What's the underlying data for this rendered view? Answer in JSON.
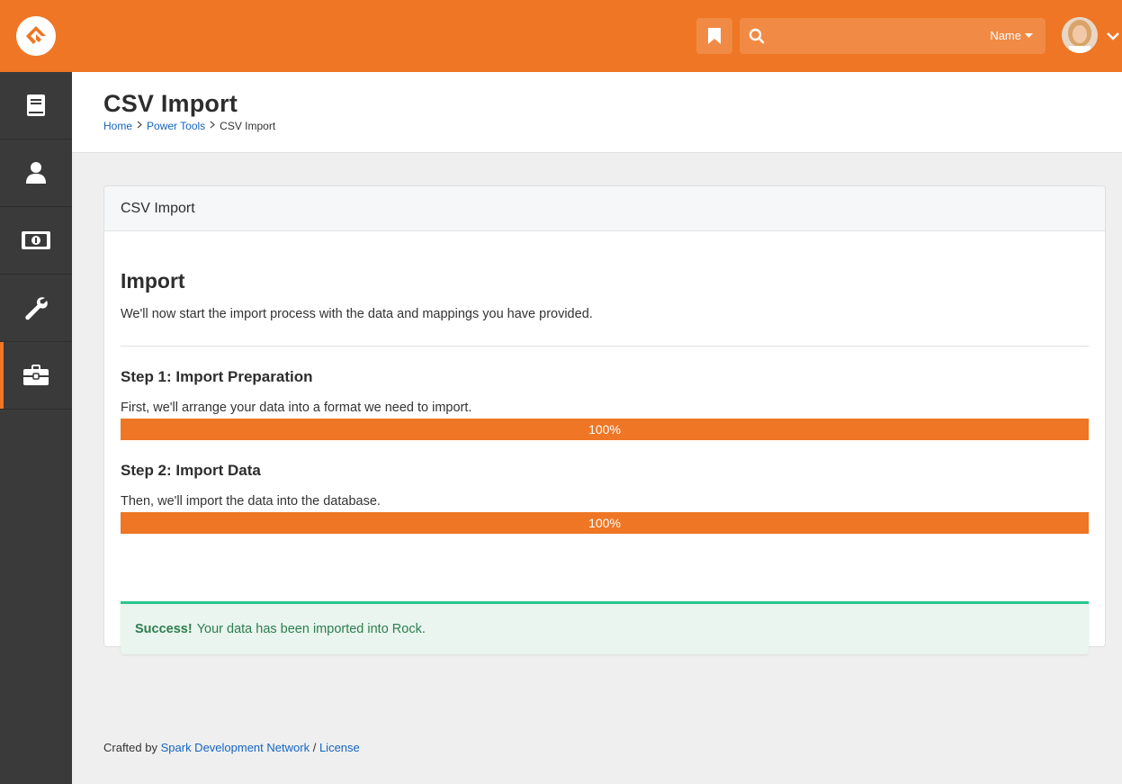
{
  "topbar": {
    "search_placeholder": "",
    "search_scope_label": "Name",
    "brand_color": "#ee7624"
  },
  "sidebar": {
    "items": [
      {
        "icon": "book-icon",
        "active": false
      },
      {
        "icon": "person-icon",
        "active": false
      },
      {
        "icon": "money-icon",
        "active": false
      },
      {
        "icon": "wrench-icon",
        "active": false
      },
      {
        "icon": "briefcase-icon",
        "active": true
      }
    ]
  },
  "header": {
    "title": "CSV Import",
    "breadcrumbs": [
      "Home",
      "Power Tools",
      "CSV Import"
    ]
  },
  "panel": {
    "heading": "CSV Import",
    "import_title": "Import",
    "import_desc": "We'll now start the import process with the data and mappings you have provided.",
    "steps": [
      {
        "title": "Step 1: Import Preparation",
        "desc": "First, we'll arrange your data into a format we need to import.",
        "progress_label": "100%",
        "progress": 1.0
      },
      {
        "title": "Step 2: Import Data",
        "desc": "Then, we'll import the data into the database.",
        "progress_label": "100%",
        "progress": 1.0
      }
    ],
    "alert": {
      "strong": "Success!",
      "text": "Your data has been imported into Rock."
    }
  },
  "footer": {
    "prefix": "Crafted by",
    "link1": "Spark Development Network",
    "separator": "/",
    "link2": "License"
  }
}
